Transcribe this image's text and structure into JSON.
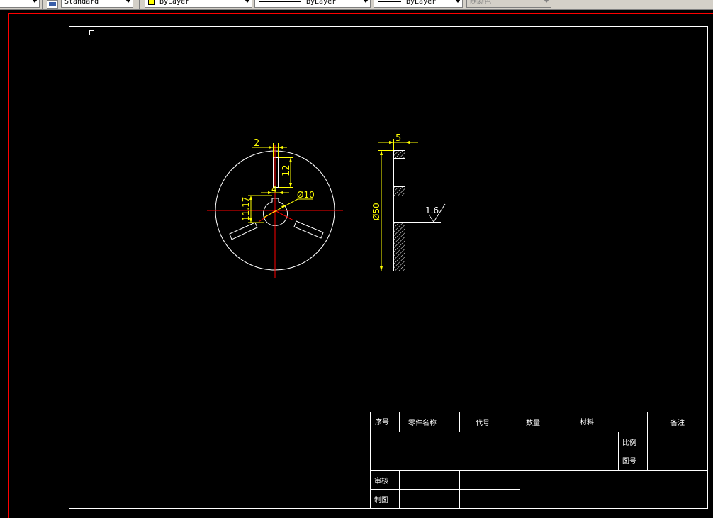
{
  "toolbar": {
    "text_style": "Standard",
    "layer_color": "ByLayer",
    "layer_color_swatch": "#ffff00",
    "linetype": "ByLayer",
    "lineweight": "ByLayer",
    "plot_style": "随颜色"
  },
  "drawing": {
    "front_view": {
      "dim_slot_width": "2",
      "dim_slot_length": "12",
      "dim_key_width": "4",
      "dim_bore_diameter": "Ø10",
      "dim_keyway_depth": "11.17"
    },
    "side_view": {
      "dim_thickness": "5",
      "dim_outer_diameter": "Ø50",
      "surface_roughness": "1.6"
    }
  },
  "title_block": {
    "headers": [
      "序号",
      "零件名称",
      "代号",
      "数量",
      "材料",
      "备注"
    ],
    "scale_label": "比例",
    "drawing_no_label": "图号",
    "checker_label": "审核",
    "drafter_label": "制图"
  },
  "colors": {
    "background": "#000000",
    "border": "#ffffff",
    "geometry": "#ffffff",
    "dimension": "#ffff00",
    "centerline": "#ff0000",
    "viewport_border": "#ff0000"
  }
}
